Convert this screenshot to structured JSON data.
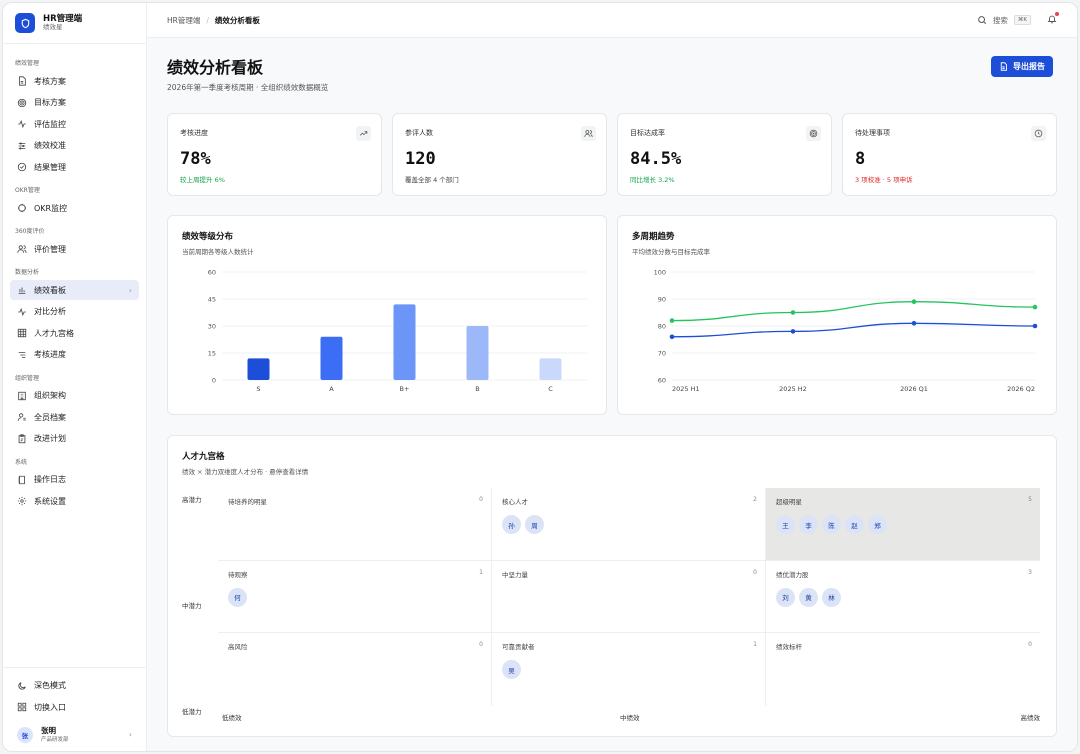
{
  "sidebar": {
    "brand_name": "HR管理端",
    "brand_sub": "绩效星",
    "groups": [
      {
        "title": "绩效管理",
        "items": [
          {
            "label": "考核方案",
            "icon": "document-icon"
          },
          {
            "label": "目标方案",
            "icon": "target-icon"
          },
          {
            "label": "评估监控",
            "icon": "pulse-icon"
          },
          {
            "label": "绩效校准",
            "icon": "sliders-icon"
          },
          {
            "label": "结果管理",
            "icon": "check-circle-icon"
          }
        ]
      },
      {
        "title": "OKR管理",
        "items": [
          {
            "label": "OKR监控",
            "icon": "crosshair-icon"
          }
        ]
      },
      {
        "title": "360度评价",
        "items": [
          {
            "label": "评价管理",
            "icon": "users-icon"
          }
        ]
      },
      {
        "title": "数据分析",
        "items": [
          {
            "label": "绩效看板",
            "icon": "bar-chart-icon",
            "active": true
          },
          {
            "label": "对比分析",
            "icon": "pulse-icon"
          },
          {
            "label": "人才九宫格",
            "icon": "grid-icon"
          },
          {
            "label": "考核进度",
            "icon": "list-icon"
          }
        ]
      },
      {
        "title": "组织管理",
        "items": [
          {
            "label": "组织架构",
            "icon": "building-icon"
          },
          {
            "label": "全员档案",
            "icon": "user-file-icon"
          },
          {
            "label": "改进计划",
            "icon": "clipboard-icon"
          }
        ]
      },
      {
        "title": "系统",
        "items": [
          {
            "label": "操作日志",
            "icon": "log-icon"
          },
          {
            "label": "系统设置",
            "icon": "gear-icon"
          }
        ]
      }
    ],
    "dark_mode": "深色模式",
    "switch_entry": "切换入口",
    "user": {
      "avatar": "张",
      "name": "张明",
      "dept": "产品研发部"
    }
  },
  "topbar": {
    "crumb_root": "HR管理端",
    "crumb_current": "绩效分析看板",
    "search": "搜索",
    "shortcut": "⌘K"
  },
  "page": {
    "title": "绩效分析看板",
    "subtitle": "2026年第一季度考核周期 · 全组织绩效数据概览",
    "export": "导出报告"
  },
  "stats": [
    {
      "label": "考核进度",
      "value": "78%",
      "note": "较上周提升 6%",
      "tone": "green",
      "icon": "trend-icon"
    },
    {
      "label": "参评人数",
      "value": "120",
      "note": "覆盖全部 4 个部门",
      "tone": "grey",
      "icon": "users-icon"
    },
    {
      "label": "目标达成率",
      "value": "84.5%",
      "note": "同比增长 3.2%",
      "tone": "green",
      "icon": "target-icon"
    },
    {
      "label": "待处理事项",
      "value": "8",
      "note": "3 项校准 · 5 项申诉",
      "tone": "red",
      "icon": "clock-icon"
    }
  ],
  "chart_data": [
    {
      "type": "bar",
      "title": "绩效等级分布",
      "subtitle": "当前周期各等级人数统计",
      "categories": [
        "S",
        "A",
        "B+",
        "B",
        "C"
      ],
      "values": [
        12,
        24,
        42,
        30,
        12
      ],
      "colors": [
        "#1d4ed8",
        "#3b6ef5",
        "#6b95f7",
        "#9db8f9",
        "#cad8fb"
      ],
      "ylim": [
        0,
        60
      ],
      "yticks": [
        0,
        15,
        30,
        45,
        60
      ],
      "grid": true
    },
    {
      "type": "line",
      "title": "多周期趋势",
      "subtitle": "平均绩效分数与目标完成率",
      "x": [
        "2025 H1",
        "2025 H2",
        "2026 Q1",
        "2026 Q2"
      ],
      "series": [
        {
          "values": [
            82,
            85,
            89,
            87
          ],
          "color": "#22c55e"
        },
        {
          "values": [
            76,
            78,
            81,
            80
          ],
          "color": "#1d4ed8"
        }
      ],
      "ylim": [
        60,
        100
      ],
      "yticks": [
        60,
        70,
        80,
        90,
        100
      ],
      "grid": true
    }
  ],
  "ninebox": {
    "title": "人才九宫格",
    "subtitle": "绩效 × 潜力双维度人才分布 · 悬停查看详情",
    "y_labels": [
      "高潜力",
      "中潜力",
      "低潜力"
    ],
    "x_labels": [
      "低绩效",
      "中绩效",
      "高绩效"
    ],
    "cells": [
      {
        "label": "待培养的明星",
        "count": "0",
        "people": []
      },
      {
        "label": "核心人才",
        "count": "2",
        "people": [
          "孙",
          "周"
        ]
      },
      {
        "label": "超级明星",
        "count": "5",
        "people": [
          "王",
          "李",
          "陈",
          "赵",
          "郑"
        ],
        "highlight": true
      },
      {
        "label": "待观察",
        "count": "1",
        "people": [
          "何"
        ]
      },
      {
        "label": "中坚力量",
        "count": "0",
        "people": []
      },
      {
        "label": "绩优潜力股",
        "count": "3",
        "people": [
          "刘",
          "黄",
          "林"
        ]
      },
      {
        "label": "高风险",
        "count": "0",
        "people": []
      },
      {
        "label": "可靠贡献者",
        "count": "1",
        "people": [
          "吴"
        ]
      },
      {
        "label": "绩效标杆",
        "count": "0",
        "people": []
      }
    ]
  },
  "colors": {
    "accent": "#1d4ed8",
    "positive": "#16a34a",
    "negative": "#dc2626",
    "highlight_cell": "#e7e7e6"
  }
}
